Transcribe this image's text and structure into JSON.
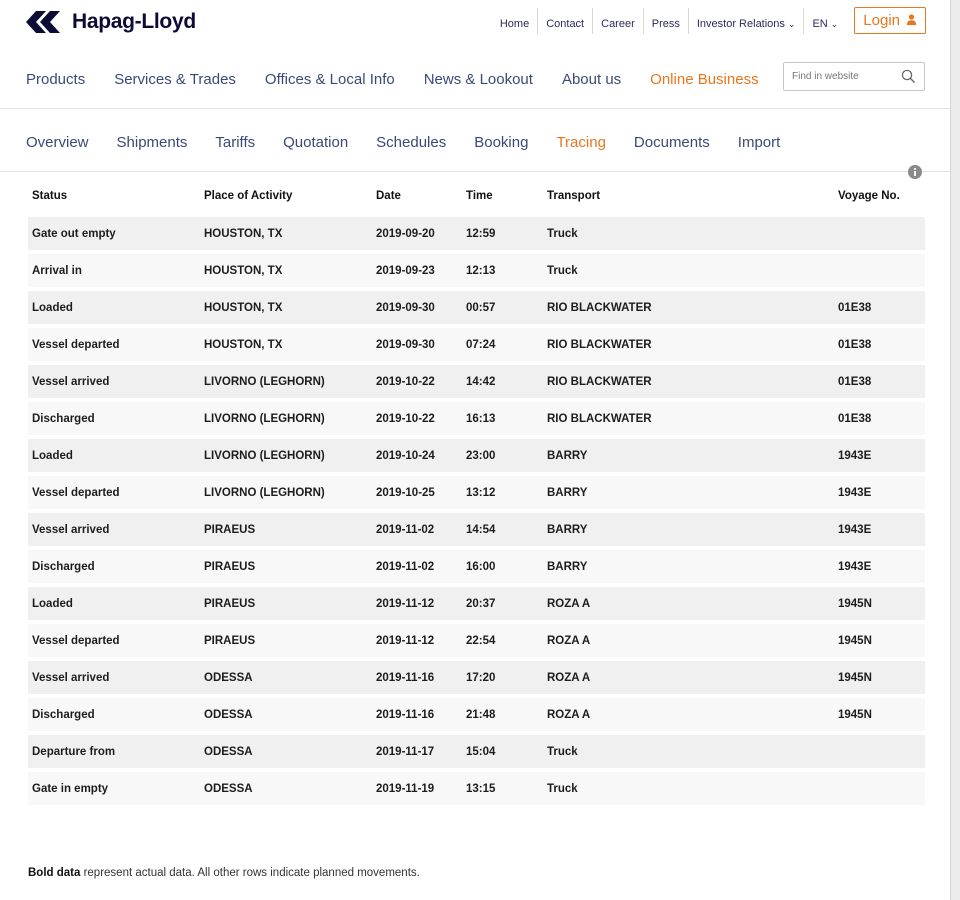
{
  "brand": {
    "name": "Hapag-Lloyd",
    "accent": "#e8761c",
    "navy": "#0b0b36"
  },
  "topnav": {
    "links": [
      "Home",
      "Contact",
      "Career",
      "Press",
      "Investor Relations",
      "EN"
    ],
    "login_label": "Login"
  },
  "mainnav": {
    "items": [
      "Products",
      "Services & Trades",
      "Offices & Local Info",
      "News & Lookout",
      "About us",
      "Online Business"
    ],
    "active": "Online Business"
  },
  "search": {
    "placeholder": "Find in website"
  },
  "subnav": {
    "items": [
      "Overview",
      "Shipments",
      "Tariffs",
      "Quotation",
      "Schedules",
      "Booking",
      "Tracing",
      "Documents",
      "Import"
    ],
    "active": "Tracing"
  },
  "table": {
    "columns": [
      "Status",
      "Place of Activity",
      "Date",
      "Time",
      "Transport",
      "Voyage No."
    ],
    "rows": [
      [
        "Gate out empty",
        "HOUSTON, TX",
        "2019-09-20",
        "12:59",
        "Truck",
        ""
      ],
      [
        "Arrival in",
        "HOUSTON, TX",
        "2019-09-23",
        "12:13",
        "Truck",
        ""
      ],
      [
        "Loaded",
        "HOUSTON, TX",
        "2019-09-30",
        "00:57",
        "RIO BLACKWATER",
        "01E38"
      ],
      [
        "Vessel departed",
        "HOUSTON, TX",
        "2019-09-30",
        "07:24",
        "RIO BLACKWATER",
        "01E38"
      ],
      [
        "Vessel arrived",
        "LIVORNO (LEGHORN)",
        "2019-10-22",
        "14:42",
        "RIO BLACKWATER",
        "01E38"
      ],
      [
        "Discharged",
        "LIVORNO (LEGHORN)",
        "2019-10-22",
        "16:13",
        "RIO BLACKWATER",
        "01E38"
      ],
      [
        "Loaded",
        "LIVORNO (LEGHORN)",
        "2019-10-24",
        "23:00",
        "BARRY",
        "1943E"
      ],
      [
        "Vessel departed",
        "LIVORNO (LEGHORN)",
        "2019-10-25",
        "13:12",
        "BARRY",
        "1943E"
      ],
      [
        "Vessel arrived",
        "PIRAEUS",
        "2019-11-02",
        "14:54",
        "BARRY",
        "1943E"
      ],
      [
        "Discharged",
        "PIRAEUS",
        "2019-11-02",
        "16:00",
        "BARRY",
        "1943E"
      ],
      [
        "Loaded",
        "PIRAEUS",
        "2019-11-12",
        "20:37",
        "ROZA A",
        "1945N"
      ],
      [
        "Vessel departed",
        "PIRAEUS",
        "2019-11-12",
        "22:54",
        "ROZA A",
        "1945N"
      ],
      [
        "Vessel arrived",
        "ODESSA",
        "2019-11-16",
        "17:20",
        "ROZA A",
        "1945N"
      ],
      [
        "Discharged",
        "ODESSA",
        "2019-11-16",
        "21:48",
        "ROZA A",
        "1945N"
      ],
      [
        "Departure from",
        "ODESSA",
        "2019-11-17",
        "15:04",
        "Truck",
        ""
      ],
      [
        "Gate in empty",
        "ODESSA",
        "2019-11-19",
        "13:15",
        "Truck",
        ""
      ]
    ]
  },
  "footnote": {
    "bold": "Bold data",
    "rest": " represent actual data. All other rows indicate planned movements."
  },
  "icons": {
    "search": "search-icon",
    "user": "user-icon",
    "info": "info-icon",
    "caret": "chevron-down-icon"
  }
}
